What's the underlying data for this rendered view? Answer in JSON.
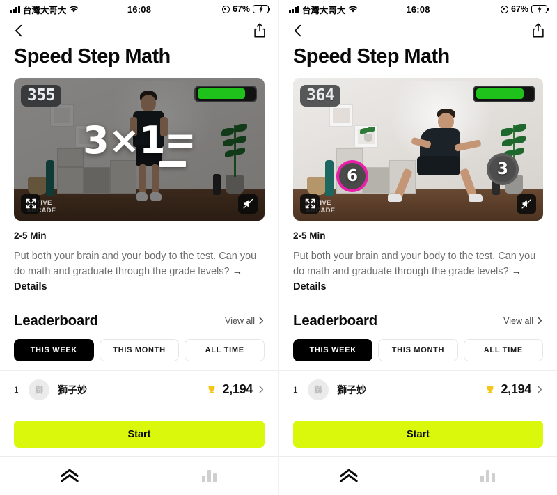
{
  "status_bar": {
    "carrier": "台灣大哥大",
    "time": "16:08",
    "battery_percent": "67%",
    "battery_level": 67,
    "charging": true,
    "signal_icon": "cellular-signal-icon",
    "wifi_icon": "wifi-icon",
    "location_icon": "location-services-icon",
    "battery_icon": "battery-charging-icon"
  },
  "nav": {
    "back_icon": "chevron-left-icon",
    "share_icon": "share-icon"
  },
  "page": {
    "title": "Speed Step Math"
  },
  "panels": [
    {
      "video": {
        "score": "355",
        "progress_percent": 85,
        "progress_color": "#1fc11b",
        "equation": "3×1=",
        "show_blank": true,
        "answers": [],
        "watermark_line1": "ACTIVE",
        "watermark_line2": "ARCADE",
        "fullscreen_icon": "fullscreen-expand-icon",
        "mute_icon": "volume-muted-icon",
        "pose": "standing"
      }
    },
    {
      "video": {
        "score": "364",
        "progress_percent": 85,
        "progress_color": "#1fc11b",
        "equation": "",
        "show_blank": false,
        "answers": [
          {
            "value": "6",
            "ring_color": "#e81fa8",
            "selected": true
          },
          {
            "value": "3",
            "ring_color": "#5d5d5d",
            "selected": false
          }
        ],
        "watermark_line1": "ACTIVE",
        "watermark_line2": "ARCADE",
        "fullscreen_icon": "fullscreen-expand-icon",
        "mute_icon": "volume-muted-icon",
        "pose": "lunging"
      }
    }
  ],
  "meta": {
    "duration": "2-5 Min",
    "description": "Put both your brain and your body to the test. Can you do math and graduate through the grade levels?",
    "details_arrow": "→",
    "details_label": "Details"
  },
  "leaderboard": {
    "title": "Leaderboard",
    "view_all_label": "View all",
    "view_all_icon": "chevron-right-icon",
    "filters": [
      {
        "label": "THIS WEEK",
        "active": true
      },
      {
        "label": "THIS MONTH",
        "active": false
      },
      {
        "label": "ALL TIME",
        "active": false
      }
    ],
    "rows": [
      {
        "rank": "1",
        "avatar_initial": "獅",
        "name": "獅子妙",
        "trophy_icon": "trophy-icon",
        "trophy_color": "#f5c518",
        "score": "2,194",
        "chevron_icon": "chevron-right-icon"
      }
    ]
  },
  "cta": {
    "start_label": "Start",
    "start_color": "#d9f80c"
  },
  "tab_bar": {
    "tabs": [
      {
        "icon": "double-chevron-up-icon",
        "active": true
      },
      {
        "icon": "bar-chart-icon",
        "active": false
      }
    ]
  }
}
